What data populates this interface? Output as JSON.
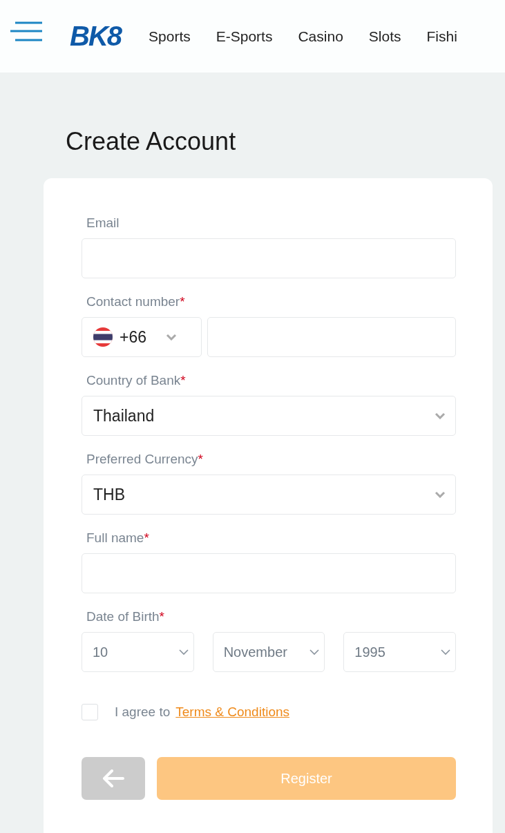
{
  "header": {
    "logo": "BK8",
    "nav": [
      {
        "label": "Sports"
      },
      {
        "label": "E-Sports"
      },
      {
        "label": "Casino"
      },
      {
        "label": "Slots"
      },
      {
        "label": "Fishi"
      }
    ]
  },
  "page_title": "Create Account",
  "form": {
    "fields": [
      {
        "kind": "text",
        "label": "Email"
      },
      {
        "kind": "phone",
        "label": "Contact number",
        "required_mark": "*",
        "code": "+66"
      },
      {
        "kind": "select",
        "label": "Country of Bank",
        "required_mark": "*",
        "value": "Thailand"
      },
      {
        "kind": "select",
        "label": "Preferred Currency",
        "required_mark": "*",
        "value": "THB"
      },
      {
        "kind": "text",
        "label": "Full name",
        "required_mark": "*"
      },
      {
        "kind": "date",
        "label": "Date of Birth",
        "required_mark": "*",
        "parts": [
          "10",
          "November",
          "1995"
        ]
      }
    ],
    "agree": {
      "checked": false,
      "text": "I agree to",
      "link": "Terms & Conditions"
    },
    "register": {
      "label": "Register",
      "disabled": true
    }
  }
}
